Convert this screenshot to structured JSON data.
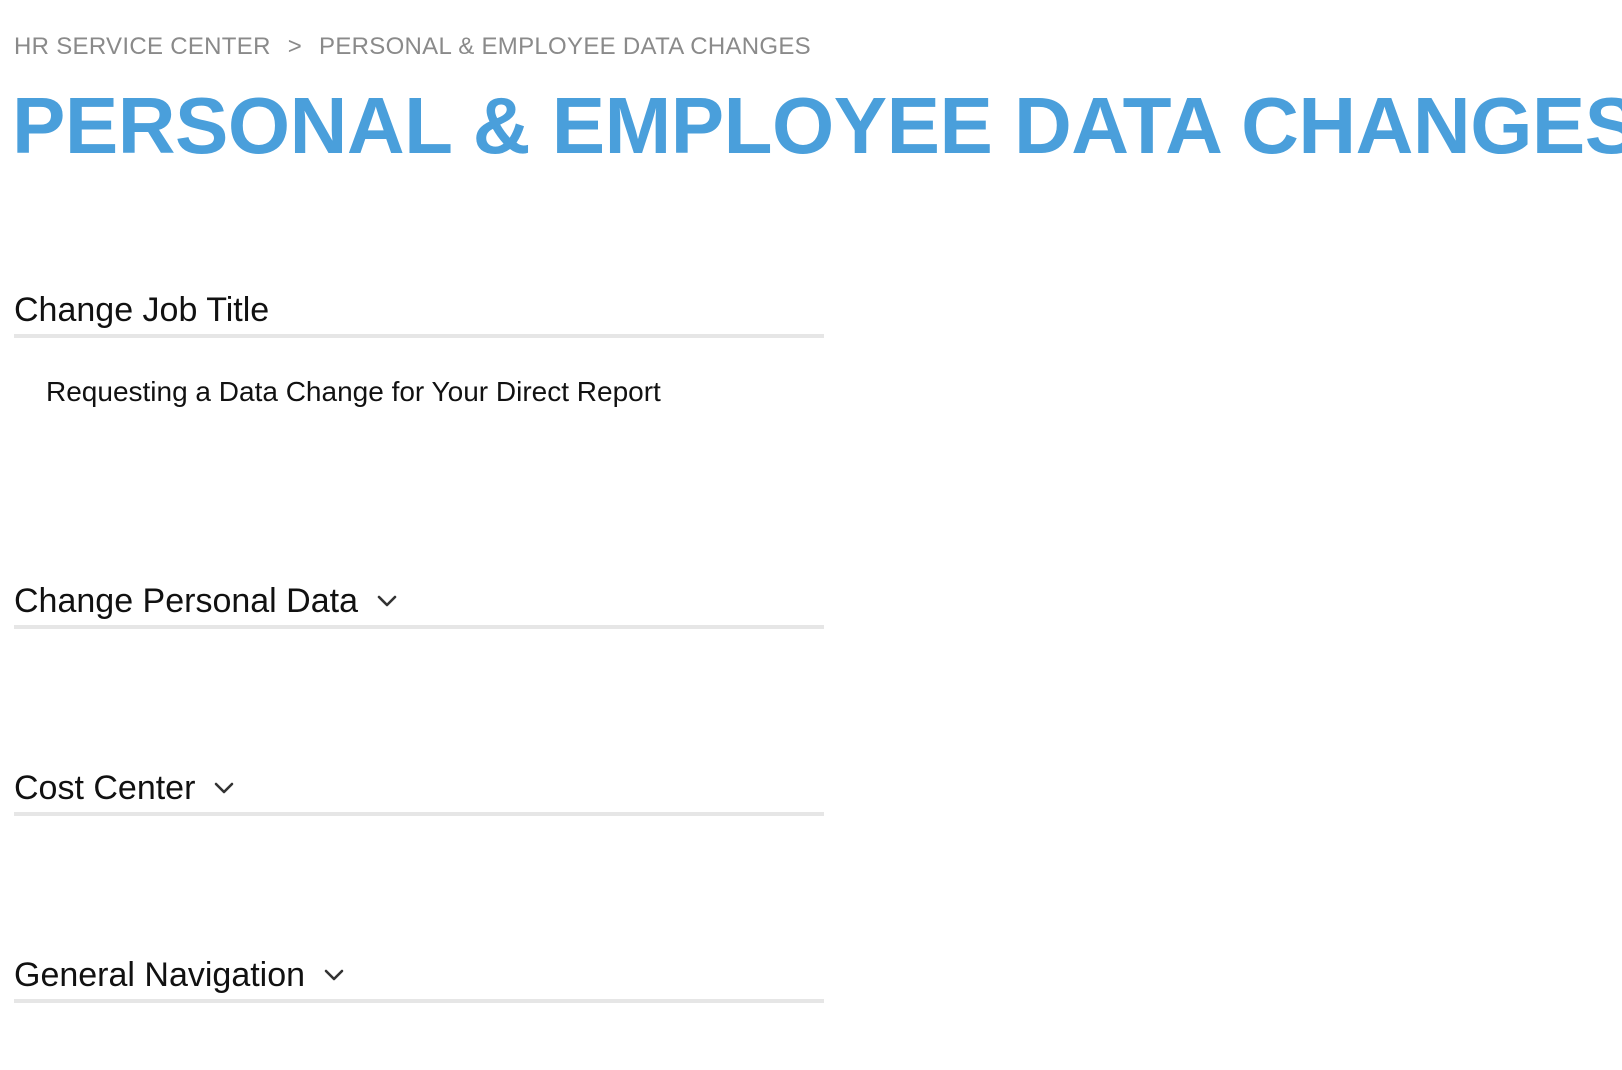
{
  "breadcrumb": {
    "root": "HR SERVICE CENTER",
    "separator": ">",
    "current": "PERSONAL & EMPLOYEE DATA CHANGES"
  },
  "page": {
    "title": "PERSONAL & EMPLOYEE DATA CHANGES"
  },
  "sections": [
    {
      "title": "Change Job Title",
      "expanded": true,
      "items": [
        {
          "label": "Requesting a Data Change for Your Direct Report"
        }
      ]
    },
    {
      "title": "Change Personal Data",
      "expanded": false,
      "icon": "chevron-down-icon"
    },
    {
      "title": "Cost Center",
      "expanded": false,
      "icon": "chevron-down-icon"
    },
    {
      "title": "General Navigation",
      "expanded": false,
      "icon": "chevron-down-icon"
    }
  ],
  "colors": {
    "title_blue": "#4a9fdb",
    "breadcrumb_gray": "#8a8a8a",
    "divider": "#e6e6e6"
  }
}
